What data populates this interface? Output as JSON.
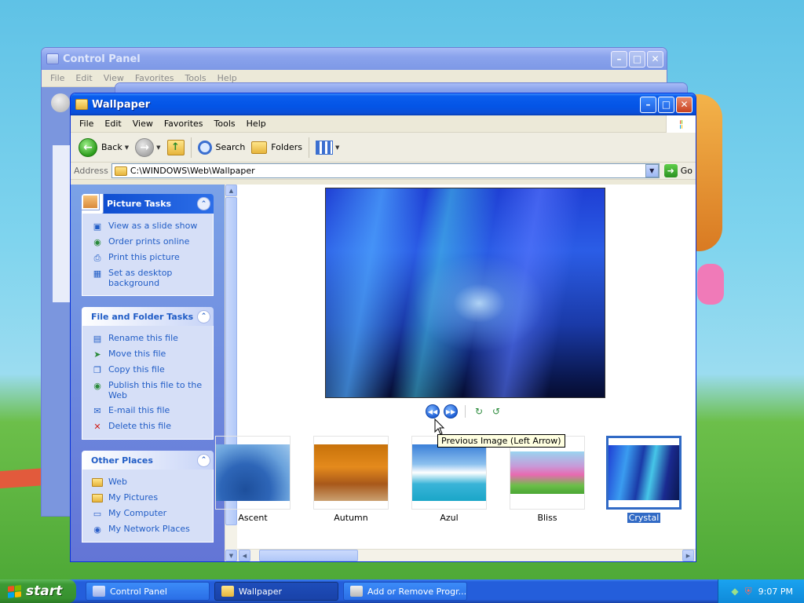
{
  "colors": {
    "xp_blue": "#0054e3",
    "link_blue": "#215dc6",
    "selection": "#316ac5",
    "start_green": "#3c9a34"
  },
  "control_panel": {
    "title": "Control Panel",
    "menu": [
      "File",
      "Edit",
      "View",
      "Favorites",
      "Tools",
      "Help"
    ]
  },
  "wallpaper": {
    "title": "Wallpaper",
    "menu": [
      "File",
      "Edit",
      "View",
      "Favorites",
      "Tools",
      "Help"
    ],
    "toolbar": {
      "back": "Back",
      "search": "Search",
      "folders": "Folders"
    },
    "address": {
      "label": "Address",
      "path": "C:\\WINDOWS\\Web\\Wallpaper",
      "go": "Go"
    },
    "picture_tasks": {
      "title": "Picture Tasks",
      "items": [
        "View as a slide show",
        "Order prints online",
        "Print this picture",
        "Set as desktop background"
      ]
    },
    "file_folder_tasks": {
      "title": "File and Folder Tasks",
      "items": [
        "Rename this file",
        "Move this file",
        "Copy this file",
        "Publish this file to the Web",
        "E-mail this file",
        "Delete this file"
      ]
    },
    "other_places": {
      "title": "Other Places",
      "items": [
        "Web",
        "My Pictures",
        "My Computer",
        "My Network Places"
      ]
    },
    "tooltip": "Previous Image (Left Arrow)",
    "thumbnails": [
      "Ascent",
      "Autumn",
      "Azul",
      "Bliss",
      "Crystal"
    ],
    "selected_thumbnail": "Crystal"
  },
  "taskbar": {
    "start": "start",
    "tasks": [
      "Control Panel",
      "Wallpaper",
      "Add or Remove Progr..."
    ],
    "clock": "9:07 PM"
  }
}
